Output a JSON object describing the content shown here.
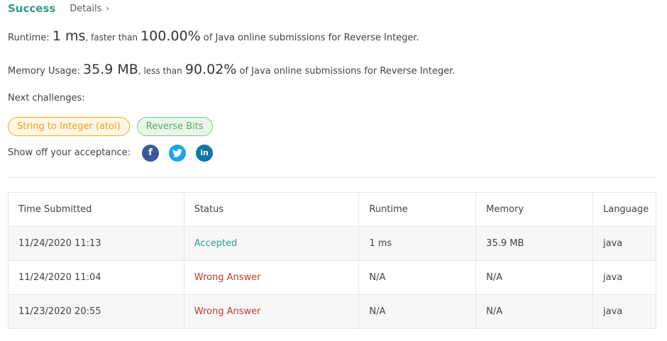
{
  "header": {
    "status_label": "Success",
    "details_label": "Details",
    "details_chevron": "›"
  },
  "runtime": {
    "label": "Runtime:",
    "value": "1 ms",
    "comparison": ", faster than",
    "percent": "100.00%",
    "suffix": "of Java online submissions for Reverse Integer."
  },
  "memory": {
    "label": "Memory Usage:",
    "value": "35.9 MB",
    "comparison": ", less than",
    "percent": "90.02%",
    "suffix": "of Java online submissions for Reverse Integer."
  },
  "next_challenges": {
    "label": "Next challenges:",
    "items": [
      "String to Integer (atoi)",
      "Reverse Bits"
    ]
  },
  "share": {
    "label": "Show off your acceptance:",
    "icons": {
      "facebook": "f",
      "twitter": "t",
      "linkedin": "in"
    }
  },
  "colors": {
    "success": "#2e9e88",
    "wrong_answer": "#c0392b",
    "facebook": "#3b5998",
    "twitter": "#1da1f2",
    "linkedin": "#0e76a8"
  },
  "table": {
    "headers": [
      "Time Submitted",
      "Status",
      "Runtime",
      "Memory",
      "Language"
    ],
    "rows": [
      {
        "time": "11/24/2020 11:13",
        "status": "Accepted",
        "runtime": "1 ms",
        "memory": "35.9 MB",
        "language": "java"
      },
      {
        "time": "11/24/2020 11:04",
        "status": "Wrong Answer",
        "runtime": "N/A",
        "memory": "N/A",
        "language": "java"
      },
      {
        "time": "11/23/2020 20:55",
        "status": "Wrong Answer",
        "runtime": "N/A",
        "memory": "N/A",
        "language": "java"
      }
    ]
  }
}
